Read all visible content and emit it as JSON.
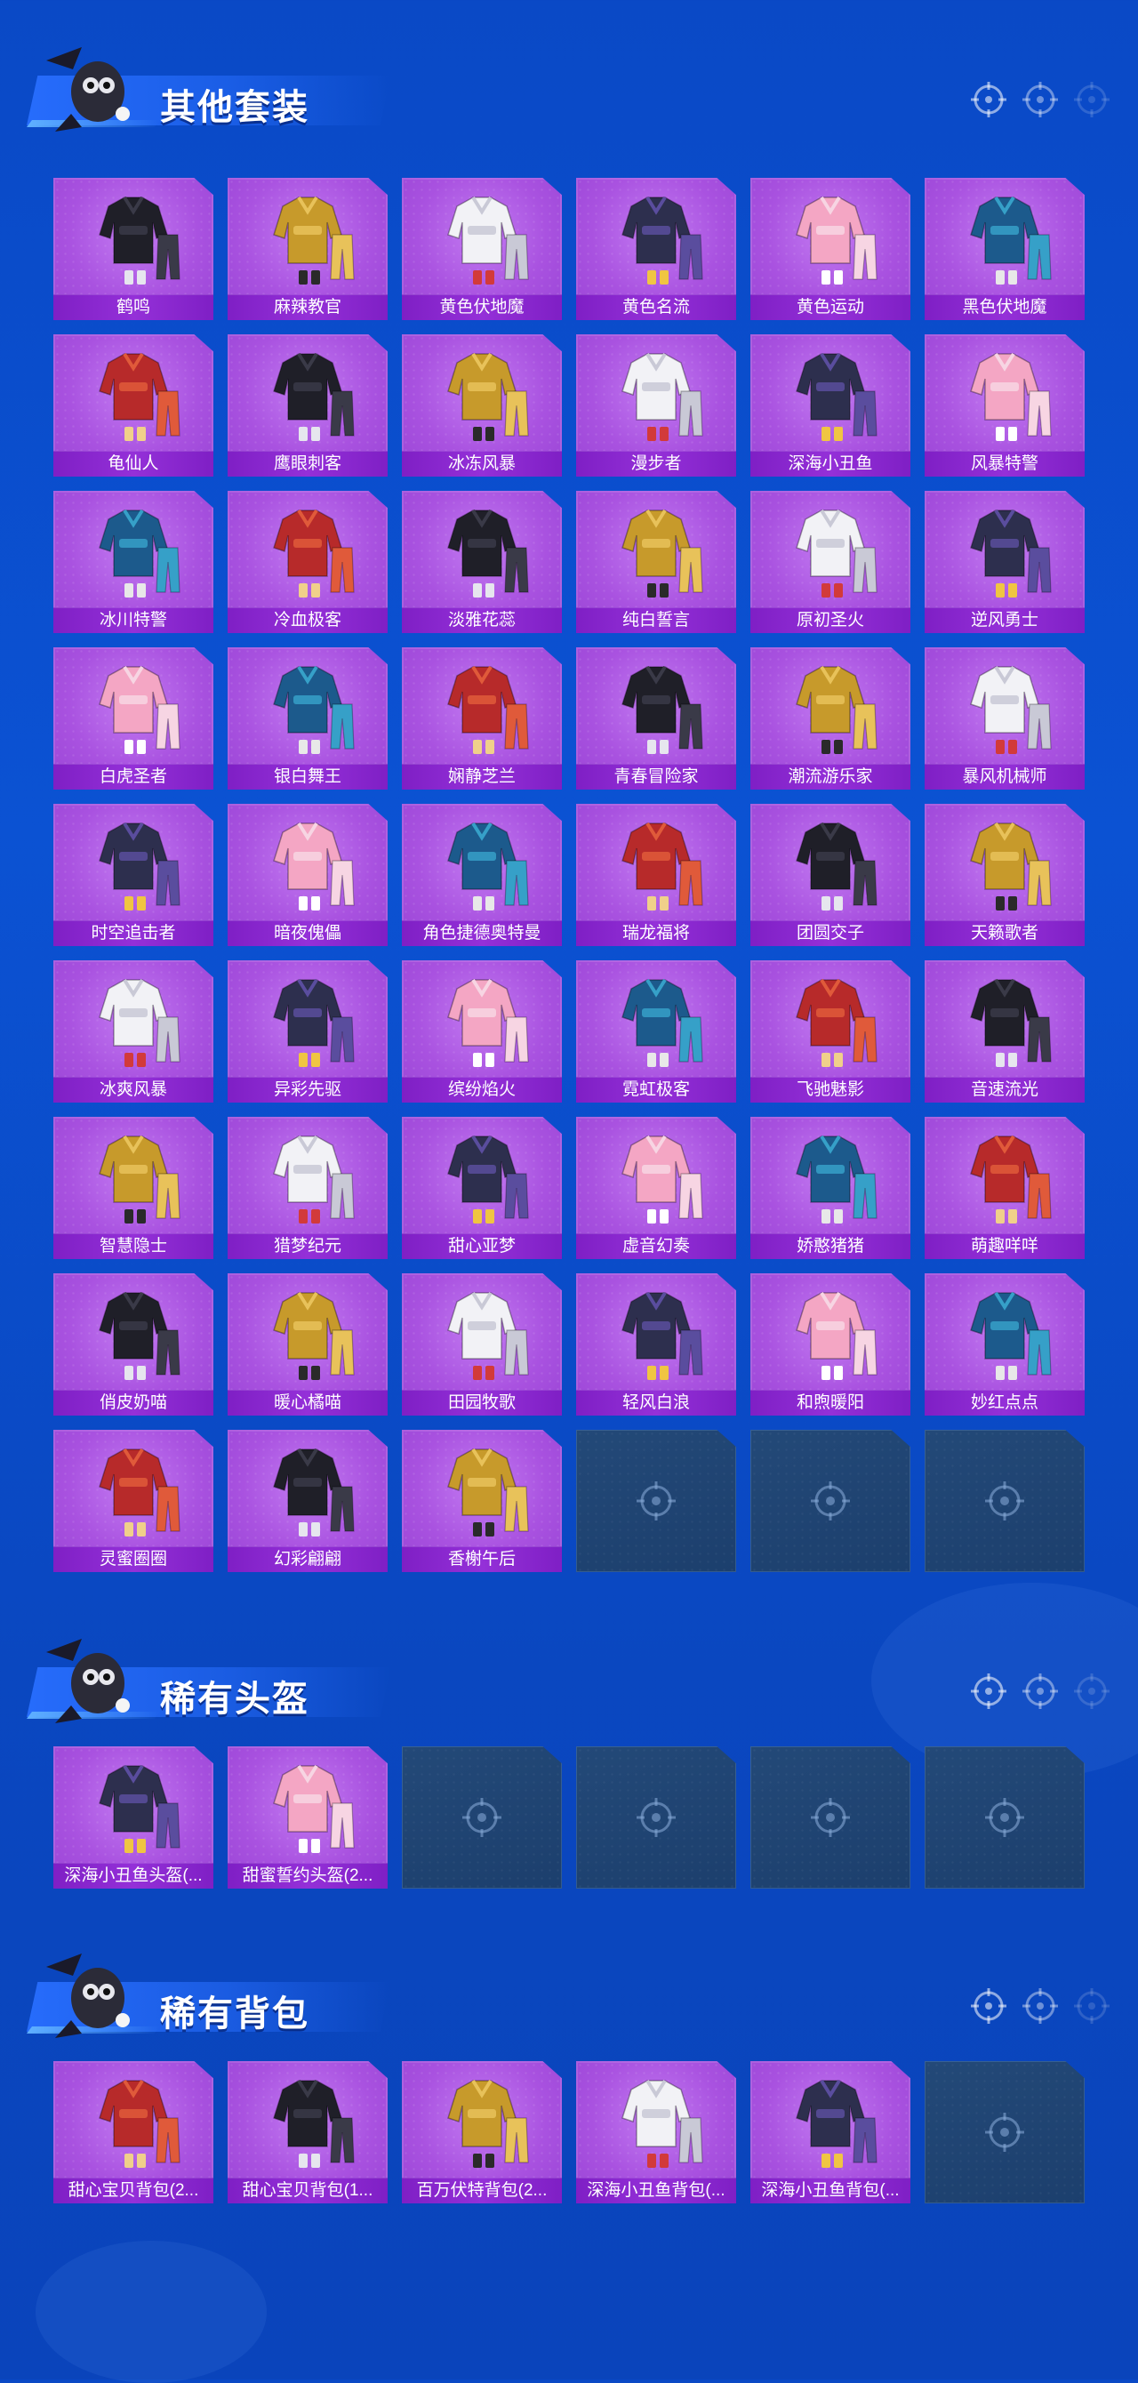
{
  "sections": [
    {
      "title": "其他套装",
      "items": [
        "鹤鸣",
        "麻辣教官",
        "黄色伏地魔",
        "黄色名流",
        "黄色运动",
        "黑色伏地魔",
        "龟仙人",
        "鹰眼刺客",
        "冰冻风暴",
        "漫步者",
        "深海小丑鱼",
        "风暴特警",
        "冰川特警",
        "冷血极客",
        "淡雅花蕊",
        "纯白誓言",
        "原初圣火",
        "逆风勇士",
        "白虎圣者",
        "银白舞王",
        "娴静芝兰",
        "青春冒险家",
        "潮流游乐家",
        "暴风机械师",
        "时空追击者",
        "暗夜傀儡",
        "角色捷德奥特曼",
        "瑞龙福将",
        "团圆交子",
        "天籁歌者",
        "冰爽风暴",
        "异彩先驱",
        "缤纷焰火",
        "霓虹极客",
        "飞驰魅影",
        "音速流光",
        "智慧隐士",
        "猎梦纪元",
        "甜心亚梦",
        "虚音幻奏",
        "娇憨猪猪",
        "萌趣咩咩",
        "俏皮奶喵",
        "暖心橘喵",
        "田园牧歌",
        "轻风白浪",
        "和煦暖阳",
        "妙红点点",
        "灵蜜圈圈",
        "幻彩翩翩",
        "香榭午后"
      ],
      "empty_slots": 3
    },
    {
      "title": "稀有头盔",
      "items": [
        "深海小丑鱼头盔(...",
        "甜蜜誓约头盔(2..."
      ],
      "empty_slots": 4
    },
    {
      "title": "稀有背包",
      "items": [
        "甜心宝贝背包(2...",
        "甜心宝贝背包(1...",
        "百万伏特背包(2...",
        "深海小丑鱼背包(...",
        "深海小丑鱼背包(..."
      ],
      "empty_slots": 1
    }
  ]
}
